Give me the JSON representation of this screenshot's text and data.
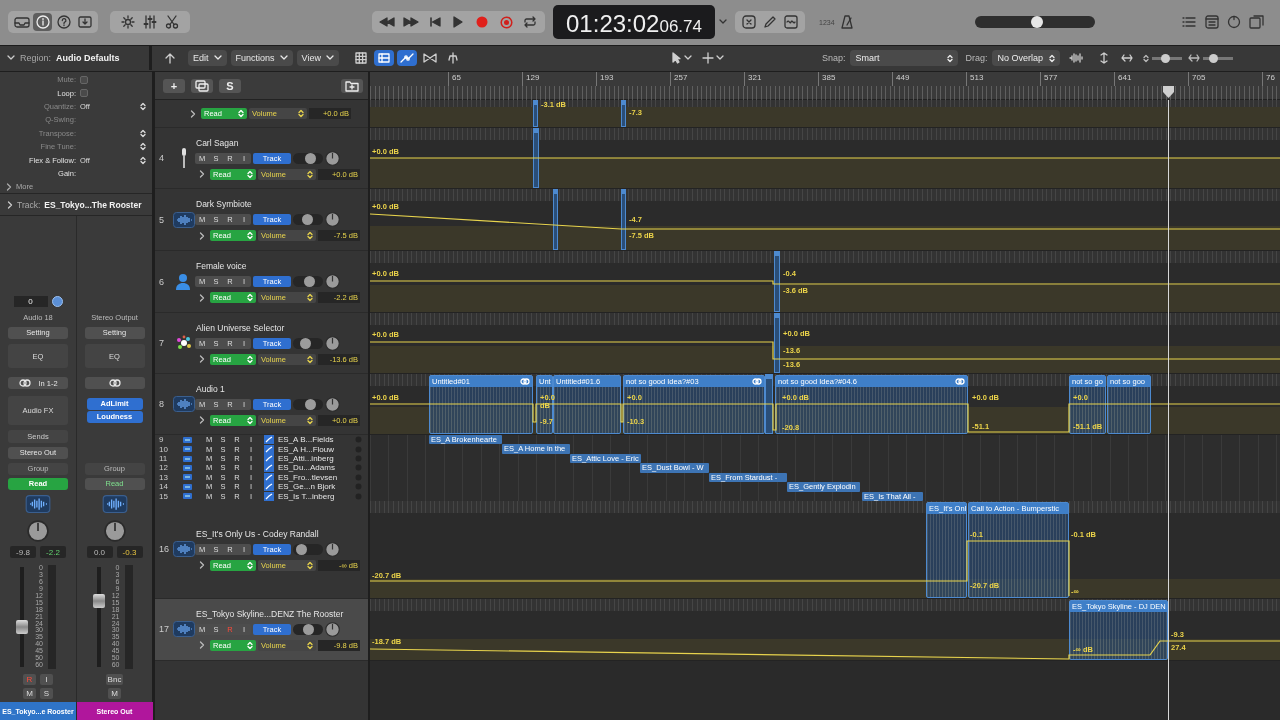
{
  "toolbar": {
    "view_buttons": [
      {
        "selected": false
      },
      {
        "selected": true
      },
      {
        "selected": false
      },
      {
        "selected": false
      }
    ],
    "lcd": {
      "time": "01:23:02",
      "subframes": "06.74"
    },
    "count_in": "1234",
    "master_volume": {
      "level": 0.52
    }
  },
  "edit_bar": {
    "inspector_heading": {
      "label": "Region:",
      "value": "Audio Defaults"
    },
    "menus": [
      "Edit",
      "Functions",
      "View"
    ],
    "view_toggles": [
      {
        "selected": false
      },
      {
        "selected": true
      },
      {
        "selected": true
      },
      {
        "selected": false
      },
      {
        "selected": false
      }
    ],
    "snap": {
      "label": "Snap:",
      "value": "Smart"
    },
    "drag": {
      "label": "Drag:",
      "value": "No Overlap"
    },
    "zoom_sliders": [
      {
        "level": 0.4
      },
      {
        "level": 0.25
      }
    ]
  },
  "inspector": {
    "region_params": [
      {
        "label": "Mute:",
        "kind": "checkbox",
        "checked": false,
        "disabled": true
      },
      {
        "label": "Loop:",
        "kind": "checkbox",
        "checked": false,
        "disabled": false
      },
      {
        "label": "Quantize:",
        "kind": "popup",
        "value": "Off",
        "disabled": true
      },
      {
        "label": "Q-Swing:",
        "kind": "plain",
        "disabled": true
      },
      {
        "label": "Transpose:",
        "kind": "popup",
        "disabled": true
      },
      {
        "label": "Fine Tune:",
        "kind": "popup",
        "disabled": true
      },
      {
        "label": "Flex & Follow:",
        "kind": "popup",
        "value": "Off",
        "disabled": false
      },
      {
        "label": "Gain:",
        "kind": "plain",
        "disabled": false
      }
    ],
    "more": "More",
    "track_heading": {
      "label": "Track:",
      "value": "ES_Tokyo...The Rooster"
    },
    "channel_strips": [
      {
        "kind": "track",
        "input_value": "0",
        "name": "Audio 18",
        "setting": "Setting",
        "eq": "EQ",
        "input": "In 1-2",
        "audio_fx": "Audio FX",
        "sends": "Sends",
        "output": "Stereo Out",
        "group": "Group",
        "automation": "Read",
        "volume_readout": "-9.8",
        "peak_readout": "-2.2",
        "fader": {
          "level": 0.39
        },
        "meter_scale": [
          "0",
          "3",
          "6",
          "9",
          "12",
          "15",
          "18",
          "21",
          "24",
          "30",
          "35",
          "40",
          "45",
          "50",
          "60"
        ],
        "record_button": "R",
        "record_armed": true,
        "input_monitor": "I",
        "mute": "M",
        "solo": "S",
        "footer": "ES_Tokyo...e Rooster",
        "color": "#2f74c8"
      },
      {
        "kind": "output",
        "name": "Stereo Output",
        "setting": "Setting",
        "eq": "EQ",
        "plugins": [
          "AdLimit",
          "Loudness"
        ],
        "group": "Group",
        "automation": "Read",
        "volume_readout": "0.0",
        "peak_readout": "-0.3",
        "fader": {
          "level": 0.69
        },
        "meter_scale": [
          "0",
          "3",
          "6",
          "9",
          "12",
          "15",
          "18",
          "21",
          "24",
          "30",
          "35",
          "40",
          "45",
          "50",
          "60"
        ],
        "bounce": "Bnc",
        "mute": "M",
        "footer": "Stereo Out",
        "color": "#b0169c"
      }
    ]
  },
  "track_list": {
    "add_button": "+",
    "solo_button": "S",
    "tracks": [
      {
        "kind": "partial",
        "automation_mode": "Read",
        "parameter": "Volume",
        "value": "+0.0 dB",
        "selected": false
      },
      {
        "kind": "full",
        "number": "4",
        "name": "Carl Sagan",
        "buttons": [
          "M",
          "S",
          "R",
          "I"
        ],
        "record_armed": false,
        "track_button": "Track",
        "fader": {
          "level": 0.62
        },
        "automation_mode": "Read",
        "parameter": "Volume",
        "value": "+0.0 dB",
        "selected": false
      },
      {
        "kind": "full",
        "number": "5",
        "name": "Dark Symbiote",
        "buttons": [
          "M",
          "S",
          "R",
          "I"
        ],
        "record_armed": false,
        "track_button": "Track",
        "fader": {
          "level": 0.45
        },
        "automation_mode": "Read",
        "parameter": "Volume",
        "value": "-7.5 dB",
        "selected": false
      },
      {
        "kind": "full",
        "number": "6",
        "name": "Female voice",
        "buttons": [
          "M",
          "S",
          "R",
          "I"
        ],
        "record_armed": false,
        "track_button": "Track",
        "fader": {
          "level": 0.6
        },
        "automation_mode": "Read",
        "parameter": "Volume",
        "value": "-2.2 dB",
        "selected": false
      },
      {
        "kind": "full",
        "number": "7",
        "name": "Alien Universe Selector",
        "buttons": [
          "M",
          "S",
          "R",
          "I"
        ],
        "record_armed": false,
        "track_button": "Track",
        "fader": {
          "level": 0.35
        },
        "automation_mode": "Read",
        "parameter": "Volume",
        "value": "-13.6 dB",
        "selected": false
      },
      {
        "kind": "full",
        "number": "8",
        "name": "Audio 1",
        "buttons": [
          "M",
          "S",
          "R",
          "I"
        ],
        "record_armed": false,
        "track_button": "Track",
        "fader": {
          "level": 0.62
        },
        "automation_mode": "Read",
        "parameter": "Volume",
        "value": "+0.0 dB",
        "selected": false
      },
      {
        "kind": "compact",
        "number": "9",
        "buttons": [
          "M",
          "S",
          "R",
          "I"
        ],
        "name": "ES_A B...Fields",
        "record_armed": false,
        "selected": false
      },
      {
        "kind": "compact",
        "number": "10",
        "buttons": [
          "M",
          "S",
          "R",
          "I"
        ],
        "name": "ES_A H...Flouw",
        "record_armed": false,
        "selected": false
      },
      {
        "kind": "compact",
        "number": "11",
        "buttons": [
          "M",
          "S",
          "R",
          "I"
        ],
        "name": "ES_Atti...inberg",
        "record_armed": false,
        "selected": false
      },
      {
        "kind": "compact",
        "number": "12",
        "buttons": [
          "M",
          "S",
          "R",
          "I"
        ],
        "name": "ES_Du...Adams",
        "record_armed": false,
        "selected": false
      },
      {
        "kind": "compact",
        "number": "13",
        "buttons": [
          "M",
          "S",
          "R",
          "I"
        ],
        "name": "ES_Fro...tlevsen",
        "record_armed": false,
        "selected": false
      },
      {
        "kind": "compact",
        "number": "14",
        "buttons": [
          "M",
          "S",
          "R",
          "I"
        ],
        "name": "ES_Ge...n Bjork",
        "record_armed": false,
        "selected": false
      },
      {
        "kind": "compact",
        "number": "15",
        "buttons": [
          "M",
          "S",
          "R",
          "I"
        ],
        "name": "ES_Is T...inberg",
        "record_armed": false,
        "selected": false
      },
      {
        "kind": "full",
        "number": "16",
        "name": "ES_It's Only Us - Codey Randall",
        "buttons": [
          "M",
          "S",
          "R",
          "I"
        ],
        "record_armed": false,
        "track_button": "Track",
        "fader": {
          "level": 0.15
        },
        "automation_mode": "Read",
        "parameter": "Volume",
        "value": "-∞ dB",
        "selected": false
      },
      {
        "kind": "full",
        "number": "17",
        "name": "ES_Tokyo Skyline...DENZ The Rooster",
        "buttons": [
          "M",
          "S",
          "R",
          "I"
        ],
        "record_armed": true,
        "track_button": "Track",
        "fader": {
          "level": 0.5
        },
        "automation_mode": "Read",
        "parameter": "Volume",
        "value": "-9.8 dB",
        "selected": true
      }
    ]
  },
  "arrangement": {
    "ruler": [
      "65",
      "129",
      "193",
      "257",
      "321",
      "385",
      "449",
      "513",
      "577",
      "641",
      "705",
      "76"
    ],
    "lanes": [
      {
        "automation": [
          "-3.1 dB",
          "-7.3"
        ]
      },
      {
        "automation": [
          "+0.0 dB"
        ]
      },
      {
        "automation": [
          "+0.0 dB",
          "-4.7",
          "-7.5 dB"
        ]
      },
      {
        "automation": [
          "+0.0 dB",
          "-0.4",
          "-3.6 dB"
        ]
      },
      {
        "automation": [
          "+0.0 dB",
          "+0.0 dB",
          "-13.6",
          "-13.6"
        ]
      },
      {
        "regions": [
          {
            "label": "Untitled#01",
            "looped": true
          },
          {
            "label": "Unt",
            "looped": false
          },
          {
            "label": "Untitled#01.6",
            "looped": false
          },
          {
            "label": "not so good Idea?#03",
            "looped": true
          },
          {
            "label": "not so good Idea?#04.6",
            "looped": true
          },
          {
            "label": "not so go",
            "looped": false
          },
          {
            "label": "not so goo",
            "looped": false
          }
        ],
        "automation": [
          "+0.0 dB",
          "+0.0 dB",
          "-9.7",
          "+0.0",
          "-10.3",
          "+0.0 dB",
          "-20.8",
          "+0.0 dB",
          "-51.1",
          "+0.0",
          "-51.1 dB"
        ]
      },
      {
        "regions": [
          {
            "label": "ES_A Brokenhearte",
            "looped": false
          }
        ]
      },
      {
        "regions": [
          {
            "label": "ES_A Home in the",
            "looped": false
          }
        ]
      },
      {
        "regions": [
          {
            "label": "ES_Attic Love - Eric",
            "looped": false
          }
        ]
      },
      {
        "regions": [
          {
            "label": "ES_Dust Bowl - W",
            "looped": false
          }
        ]
      },
      {
        "regions": [
          {
            "label": "ES_From Stardust -",
            "looped": false
          }
        ]
      },
      {
        "regions": [
          {
            "label": "ES_Gently Explodin",
            "looped": false
          }
        ]
      },
      {
        "regions": [
          {
            "label": "ES_Is That All -",
            "looped": false
          }
        ]
      },
      {
        "regions": [
          {
            "label": "ES_It's Onl",
            "looped": false
          },
          {
            "label": "Call to Action - Bumperstic",
            "looped": false
          }
        ],
        "automation": [
          "-20.7 dB",
          "-0.1",
          "-20.7 dB",
          "-0.1 dB",
          "-∞"
        ]
      },
      {
        "regions": [
          {
            "label": "ES_Tokyo Skyline - DJ DEN",
            "looped": false
          }
        ],
        "automation": [
          "-18.7 dB",
          "-∞ dB",
          "-9.3",
          "27.4"
        ]
      }
    ]
  }
}
